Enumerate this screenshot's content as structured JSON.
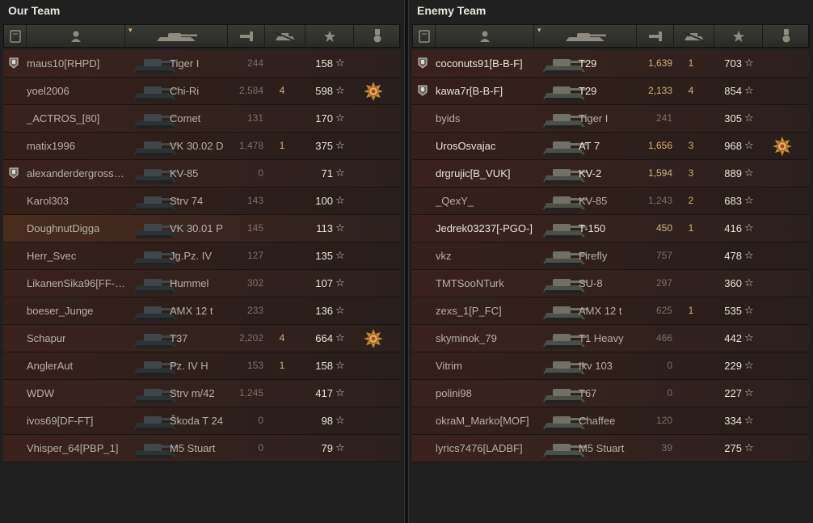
{
  "our_team": {
    "title": "Our Team",
    "players": [
      {
        "name": "maus10[RHPD]",
        "vehicle": "Tiger I",
        "damage": "244",
        "kills": "",
        "xp": "158",
        "badge": true,
        "medal": false
      },
      {
        "name": "yoel2006",
        "vehicle": "Chi-Ri",
        "damage": "2,584",
        "kills": "4",
        "xp": "598",
        "badge": false,
        "medal": true
      },
      {
        "name": "_ACTROS_[80]",
        "vehicle": "Comet",
        "damage": "131",
        "kills": "",
        "xp": "170",
        "badge": false,
        "medal": false
      },
      {
        "name": "matix1996",
        "vehicle": "VK 30.02 D",
        "damage": "1,478",
        "kills": "1",
        "xp": "375",
        "badge": false,
        "medal": false
      },
      {
        "name": "alexanderdergrosse6..",
        "vehicle": "KV-85",
        "damage": "0",
        "kills": "",
        "xp": "71",
        "badge": true,
        "medal": false
      },
      {
        "name": "Karol303",
        "vehicle": "Strv 74",
        "damage": "143",
        "kills": "",
        "xp": "100",
        "badge": false,
        "medal": false
      },
      {
        "name": "DoughnutDigga",
        "vehicle": "VK 30.01 P",
        "damage": "145",
        "kills": "",
        "xp": "113",
        "badge": false,
        "medal": false,
        "highlight": true
      },
      {
        "name": "Herr_Svec",
        "vehicle": "Jg.Pz. IV",
        "damage": "127",
        "kills": "",
        "xp": "135",
        "badge": false,
        "medal": false
      },
      {
        "name": "LikanenSika96[FF-TB]",
        "vehicle": "Hummel",
        "damage": "302",
        "kills": "",
        "xp": "107",
        "badge": false,
        "medal": false
      },
      {
        "name": "boeser_Junge",
        "vehicle": "AMX 12 t",
        "damage": "233",
        "kills": "",
        "xp": "136",
        "badge": false,
        "medal": false
      },
      {
        "name": "Schapur",
        "vehicle": "T37",
        "damage": "2,202",
        "kills": "4",
        "xp": "664",
        "badge": false,
        "medal": true
      },
      {
        "name": "AnglerAut",
        "vehicle": "Pz. IV H",
        "damage": "153",
        "kills": "1",
        "xp": "158",
        "badge": false,
        "medal": false
      },
      {
        "name": "WDW",
        "vehicle": "Strv m/42",
        "damage": "1,245",
        "kills": "",
        "xp": "417",
        "badge": false,
        "medal": false
      },
      {
        "name": "ivos69[DF-FT]",
        "vehicle": "Škoda T 24",
        "damage": "0",
        "kills": "",
        "xp": "98",
        "badge": false,
        "medal": false
      },
      {
        "name": "Vhisper_64[PBP_1]",
        "vehicle": "M5 Stuart",
        "damage": "0",
        "kills": "",
        "xp": "79",
        "badge": false,
        "medal": false
      }
    ]
  },
  "enemy_team": {
    "title": "Enemy Team",
    "players": [
      {
        "name": "coconuts91[B-B-F]",
        "vehicle": "T29",
        "damage": "1,639",
        "kills": "1",
        "xp": "703",
        "badge": true,
        "medal": false,
        "bright": true
      },
      {
        "name": "kawa7r[B-B-F]",
        "vehicle": "T29",
        "damage": "2,133",
        "kills": "4",
        "xp": "854",
        "badge": true,
        "medal": false,
        "bright": true
      },
      {
        "name": "byids",
        "vehicle": "Tiger I",
        "damage": "241",
        "kills": "",
        "xp": "305",
        "badge": false,
        "medal": false
      },
      {
        "name": "UrosOsvajac",
        "vehicle": "AT 7",
        "damage": "1,656",
        "kills": "3",
        "xp": "968",
        "badge": false,
        "medal": true,
        "bright": true
      },
      {
        "name": "drgrujic[B_VUK]",
        "vehicle": "KV-2",
        "damage": "1,594",
        "kills": "3",
        "xp": "889",
        "badge": false,
        "medal": false,
        "bright": true
      },
      {
        "name": "_QexY_",
        "vehicle": "KV-85",
        "damage": "1,243",
        "kills": "2",
        "xp": "683",
        "badge": false,
        "medal": false
      },
      {
        "name": "Jedrek03237[-PGO-]",
        "vehicle": "T-150",
        "damage": "450",
        "kills": "1",
        "xp": "416",
        "badge": false,
        "medal": false,
        "bright": true
      },
      {
        "name": "vkz",
        "vehicle": "Firefly",
        "damage": "757",
        "kills": "",
        "xp": "478",
        "badge": false,
        "medal": false
      },
      {
        "name": "TMTSooNTurk",
        "vehicle": "SU-8",
        "damage": "297",
        "kills": "",
        "xp": "360",
        "badge": false,
        "medal": false
      },
      {
        "name": "zexs_1[P_FC]",
        "vehicle": "AMX 12 t",
        "damage": "625",
        "kills": "1",
        "xp": "535",
        "badge": false,
        "medal": false
      },
      {
        "name": "skyminok_79",
        "vehicle": "T1 Heavy",
        "damage": "466",
        "kills": "",
        "xp": "442",
        "badge": false,
        "medal": false
      },
      {
        "name": "Vitrim",
        "vehicle": "Ikv 103",
        "damage": "0",
        "kills": "",
        "xp": "229",
        "badge": false,
        "medal": false
      },
      {
        "name": "polini98",
        "vehicle": "T67",
        "damage": "0",
        "kills": "",
        "xp": "227",
        "badge": false,
        "medal": false
      },
      {
        "name": "okraM_Marko[MOF]",
        "vehicle": "Chaffee",
        "damage": "120",
        "kills": "",
        "xp": "334",
        "badge": false,
        "medal": false
      },
      {
        "name": "lyrics7476[LADBF]",
        "vehicle": "M5 Stuart",
        "damage": "39",
        "kills": "",
        "xp": "275",
        "badge": false,
        "medal": false
      }
    ]
  },
  "header_icons": [
    "squad-icon",
    "player-icon",
    "tank-icon",
    "damage-icon",
    "kills-icon",
    "xp-star-icon",
    "medal-icon"
  ],
  "star_glyph": "☆",
  "colors": {
    "gold": "#d4b174",
    "dim": "#77736b",
    "bright": "#e8e5d8",
    "row": "#3a211d"
  }
}
